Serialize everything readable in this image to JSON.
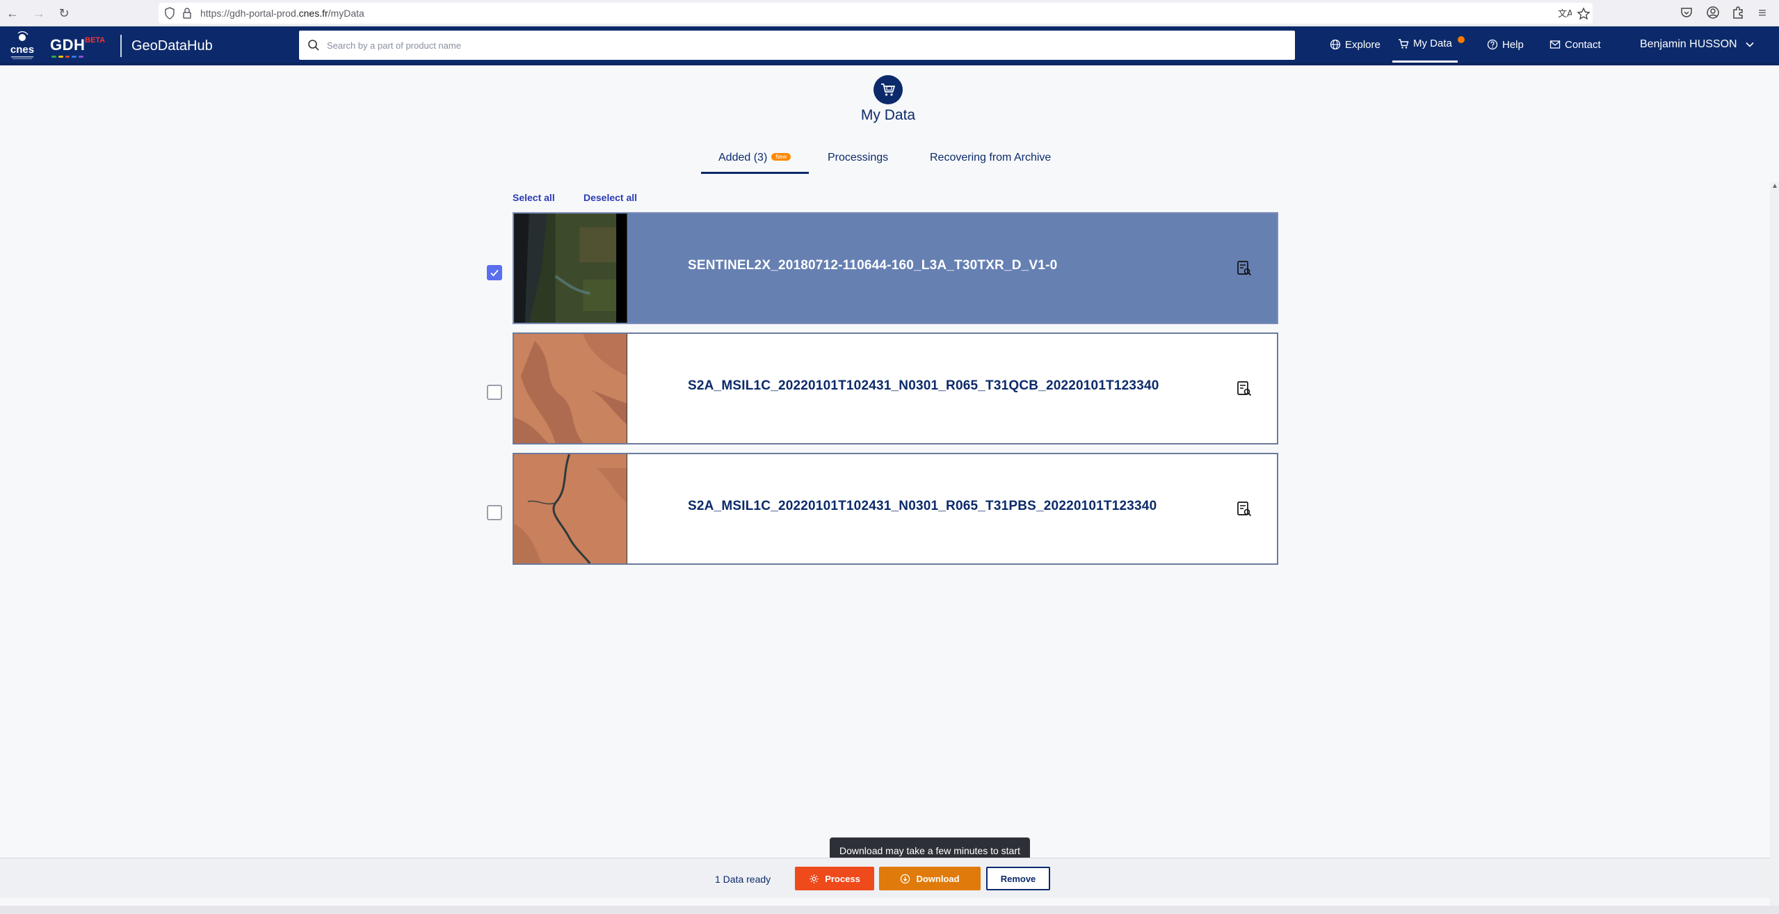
{
  "browser": {
    "url_prefix": "https://gdh-portal-prod.",
    "url_domain": "cnes.fr",
    "url_path": "/myData"
  },
  "header": {
    "logo_text": "cnes",
    "brand": "GDH",
    "beta_label": "BETA",
    "app_name": "GeoDataHub",
    "search_placeholder": "Search by a part of product name",
    "nav": [
      {
        "label": "Explore",
        "icon": "globe-icon"
      },
      {
        "label": "My Data",
        "icon": "cart-icon"
      },
      {
        "label": "Help",
        "icon": "help-icon"
      },
      {
        "label": "Contact",
        "icon": "mail-icon"
      }
    ],
    "user_name": "Benjamin HUSSON"
  },
  "page": {
    "title": "My Data",
    "tabs": [
      {
        "label": "Added (3)",
        "badge": "New",
        "active": true
      },
      {
        "label": "Processings",
        "active": false
      },
      {
        "label": "Recovering from Archive",
        "active": false
      }
    ],
    "select_all": "Select all",
    "deselect_all": "Deselect all"
  },
  "products": [
    {
      "name": "SENTINEL2X_20180712-110644-160_L3A_T30TXR_D_V1-0",
      "selected": true
    },
    {
      "name": "S2A_MSIL1C_20220101T102431_N0301_R065_T31QCB_20220101T123340",
      "selected": false
    },
    {
      "name": "S2A_MSIL1C_20220101T102431_N0301_R065_T31PBS_20220101T123340",
      "selected": false
    }
  ],
  "footer": {
    "status": "1 Data ready",
    "process_label": "Process",
    "download_label": "Download",
    "remove_label": "Remove",
    "tooltip": "Download may take a few minutes to start"
  },
  "colors": {
    "header_bg": "#0c2a6b",
    "selected_row": "#6680b2",
    "process": "#ef4a1c",
    "download": "#e07a0a",
    "checkbox": "#5a6ef0",
    "notification": "#ff7a00"
  }
}
